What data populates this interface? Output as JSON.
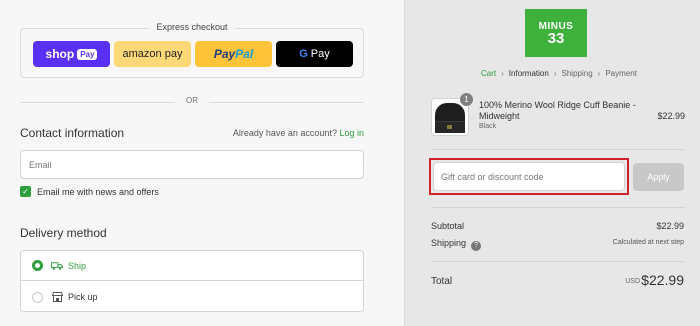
{
  "express": {
    "title": "Express checkout",
    "shop_pay": {
      "label": "shop",
      "tag": "Pay"
    },
    "amazon_pay": "amazon pay",
    "paypal": {
      "part1": "Pay",
      "part2": "Pal"
    },
    "gpay": {
      "g": "G",
      "label": "Pay"
    }
  },
  "or_text": "OR",
  "contact": {
    "title": "Contact information",
    "account_prompt": "Already have an account?",
    "login_link": "Log in",
    "email_placeholder": "Email",
    "email_value": "",
    "newsletter_label": "Email me with news and offers",
    "newsletter_checked": true
  },
  "delivery": {
    "title": "Delivery method",
    "options": [
      {
        "label": "Ship",
        "selected": true,
        "icon": "truck-icon"
      },
      {
        "label": "Pick up",
        "selected": false,
        "icon": "store-icon"
      }
    ]
  },
  "brand": {
    "line1": "MINUS",
    "line2": "33",
    "color": "#3db13b"
  },
  "breadcrumbs": [
    "Cart",
    "Information",
    "Shipping",
    "Payment"
  ],
  "product": {
    "name": "100% Merino Wool Ridge Cuff Beanie - Midweight",
    "variant": "Black",
    "price": "$22.99",
    "quantity": "1"
  },
  "discount": {
    "placeholder": "Gift card or discount code",
    "value": "",
    "apply_label": "Apply"
  },
  "summary": {
    "subtotal_label": "Subtotal",
    "subtotal_value": "$22.99",
    "shipping_label": "Shipping",
    "shipping_value": "Calculated at next step",
    "total_label": "Total",
    "currency": "USD",
    "total_value": "$22.99"
  },
  "colors": {
    "accent": "#2e9e3e",
    "highlight": "#d0202c",
    "shop_pay": "#5a31f4",
    "paypal": "#ffc439"
  }
}
